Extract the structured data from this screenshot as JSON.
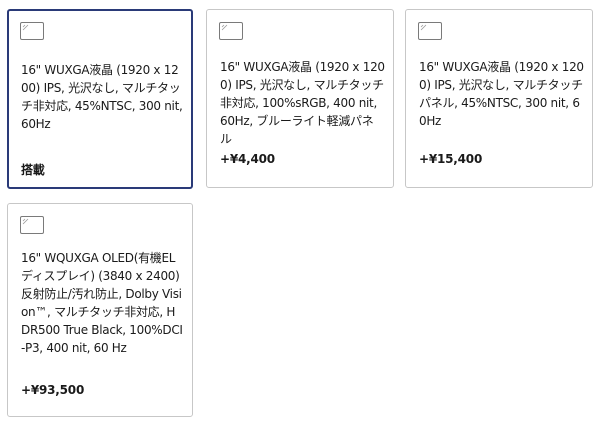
{
  "options": [
    {
      "description": "16\" WUXGA液晶 (1920 x 1200) IPS, 光沢なし, マルチタッチ非対応, 45%NTSC, 300 nit, 60Hz",
      "price": "搭載",
      "selected": true
    },
    {
      "description": "16\" WUXGA液晶 (1920 x 1200) IPS, 光沢なし, マルチタッチ非対応, 100%sRGB, 400 nit, 60Hz, ブルーライト軽減パネル",
      "price": "+¥4,400",
      "selected": false
    },
    {
      "description": "16\" WUXGA液晶 (1920 x 1200) IPS, 光沢なし, マルチタッチパネル, 45%NTSC, 300 nit, 60Hz",
      "price": "+¥15,400",
      "selected": false
    },
    {
      "description": "16\" WQUXGA OLED(有機ELディスプレイ) (3840 x 2400) 反射防止/汚れ防止, Dolby Vision™, マルチタッチ非対応, HDR500 True Black, 100%DCI-P3, 400 nit, 60 Hz",
      "price": "+¥93,500",
      "selected": false
    }
  ],
  "icons": {
    "thumbnail": "display-thumbnail-icon"
  },
  "colors": {
    "selected_border": "#2a3a78",
    "card_border": "#c7c7c7"
  }
}
